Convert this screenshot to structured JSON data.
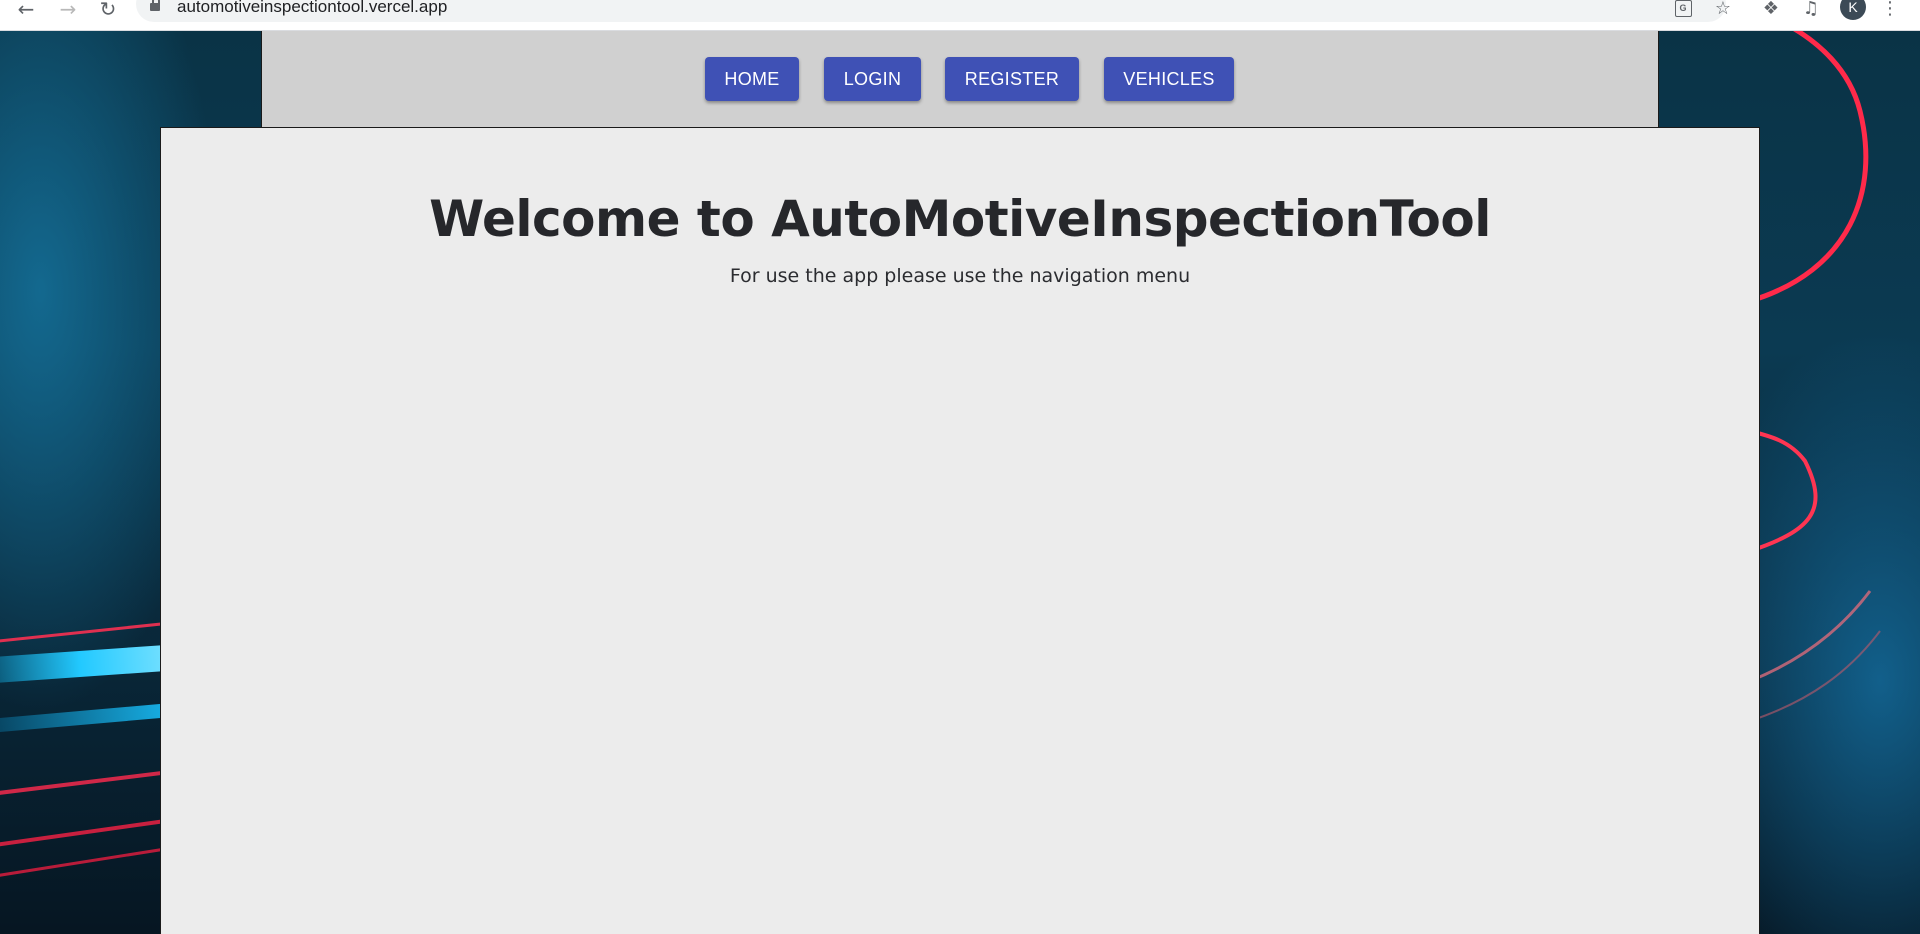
{
  "browser": {
    "url": "automotiveinspectiontool.vercel.app",
    "avatar_initial": "K",
    "icons": [
      "back-icon",
      "forward-icon",
      "reload-icon",
      "lock-icon",
      "translate-icon",
      "star-icon",
      "extensions-icon",
      "media-icon",
      "more-icon"
    ]
  },
  "nav": {
    "home": "HOME",
    "login": "LOGIN",
    "register": "REGISTER",
    "vehicles": "VEHICLES",
    "button_color": "#3f51b5"
  },
  "main": {
    "title": "Welcome to AutoMotiveInspectionTool",
    "subtitle": "For use the app please use the navigation menu"
  }
}
